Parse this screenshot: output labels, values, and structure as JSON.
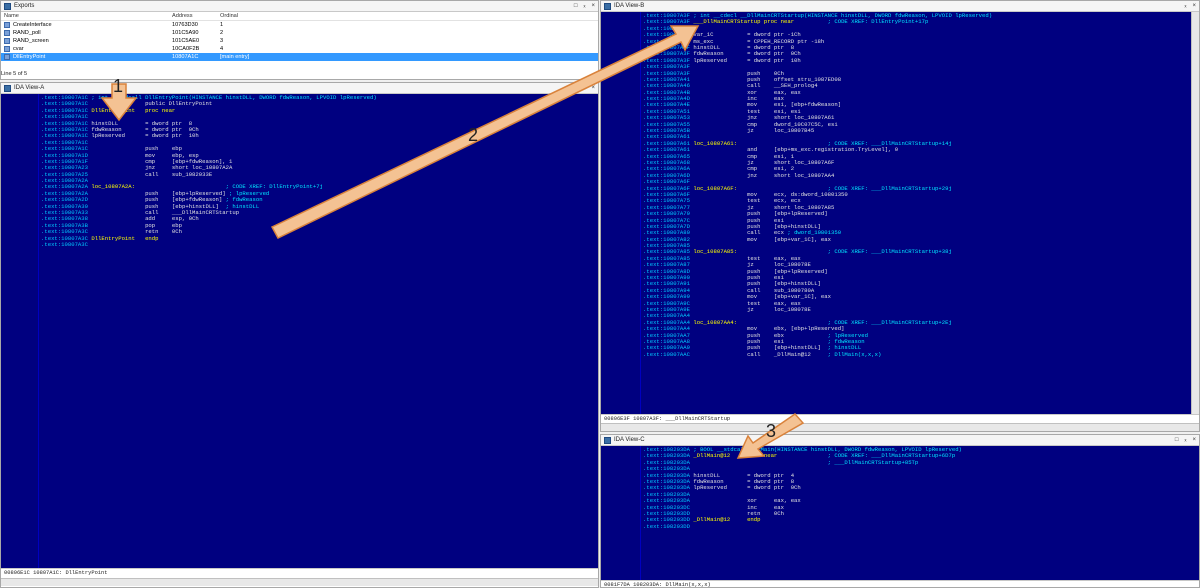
{
  "exports": {
    "title": "Exports",
    "columns": [
      "Name",
      "Address",
      "Ordinal"
    ],
    "rows": [
      {
        "name": "CreateInterface",
        "address": "10763D30",
        "ordinal": "1"
      },
      {
        "name": "RAND_poll",
        "address": "101C5A90",
        "ordinal": "2"
      },
      {
        "name": "RAND_screen",
        "address": "101C5AE0",
        "ordinal": "3"
      },
      {
        "name": "cvar",
        "address": "10CA0F2B",
        "ordinal": "4"
      },
      {
        "name": "DllEntryPoint",
        "address": "10807A1C",
        "ordinal": "[main entry]"
      }
    ],
    "status": "Line 5 of 5"
  },
  "viewA": {
    "title": "IDA View-A",
    "status": "00806E1C 10807A1C: DllEntryPoint",
    "lines": [
      ".text:10807A1C ; int __stdcall DllEntryPoint(HINSTANCE hinstDLL, DWORD fdwReason, LPVOID lpReserved)",
      ".text:10807A1C                 public DllEntryPoint",
      ".text:10807A1C DllEntryPoint   proc near",
      ".text:10807A1C",
      ".text:10807A1C hinstDLL        = dword ptr  8",
      ".text:10807A1C fdwReason       = dword ptr  0Ch",
      ".text:10807A1C lpReserved      = dword ptr  10h",
      ".text:10807A1C",
      ".text:10807A1C                 push    ebp",
      ".text:10807A1D                 mov     ebp, esp",
      ".text:10807A1F                 cmp     [ebp+fdwReason], 1",
      ".text:10807A23                 jnz     short loc_10807A2A",
      ".text:10807A25                 call    sub_1082033E",
      ".text:10807A2A",
      ".text:10807A2A loc_10807A2A:                           ; CODE XREF: DllEntryPoint+7j",
      ".text:10807A2A                 push    [ebp+lpReserved] ; lpReserved",
      ".text:10807A2D                 push    [ebp+fdwReason] ; fdwReason",
      ".text:10807A30                 push    [ebp+hinstDLL]  ; hinstDLL",
      ".text:10807A33                 call    ___DllMainCRTStartup",
      ".text:10807A38                 add     esp, 0Ch",
      ".text:10807A3B                 pop     ebp",
      ".text:10807A3C                 retn    0Ch",
      ".text:10807A3C DllEntryPoint   endp",
      ".text:10807A3C"
    ]
  },
  "viewB": {
    "title": "IDA View-B",
    "status": "00806E3F 10807A3F: ___DllMainCRTStartup",
    "lines": [
      ".text:10807A3F ; int __cdecl __DllMainCRTStartup(HINSTANCE hinstDLL, DWORD fdwReason, LPVOID lpReserved)",
      ".text:10807A3F ___DllMainCRTStartup proc near          ; CODE XREF: DllEntryPoint+17p",
      ".text:10807A3F",
      ".text:10807A3F var_1C          = dword ptr -1Ch",
      ".text:10807A3F ms_exc          = CPPEH_RECORD ptr -18h",
      ".text:10807A3F hinstDLL        = dword ptr  8",
      ".text:10807A3F fdwReason       = dword ptr  0Ch",
      ".text:10807A3F lpReserved      = dword ptr  10h",
      ".text:10807A3F",
      ".text:10807A3F                 push    0Ch",
      ".text:10807A41                 push    offset stru_1087ED08",
      ".text:10807A46                 call    __SEH_prolog4",
      ".text:10807A4B                 xor     eax, eax",
      ".text:10807A4D                 inc     eax",
      ".text:10807A4E                 mov     esi, [ebp+fdwReason]",
      ".text:10807A51                 test    esi, esi",
      ".text:10807A53                 jnz     short loc_10807A61",
      ".text:10807A55                 cmp     dword_10C07C5C, esi",
      ".text:10807A5B                 jz      loc_10807B45",
      ".text:10807A61",
      ".text:10807A61 loc_10807A61:                           ; CODE XREF: ___DllMainCRTStartup+14j",
      ".text:10807A61                 and     [ebp+ms_exc.registration.TryLevel], 0",
      ".text:10807A65                 cmp     esi, 1",
      ".text:10807A68                 jz      short loc_10807A6F",
      ".text:10807A6A                 cmp     esi, 2",
      ".text:10807A6D                 jnz     short loc_10807AA4",
      ".text:10807A6F",
      ".text:10807A6F loc_10807A6F:                           ; CODE XREF: ___DllMainCRTStartup+29j",
      ".text:10807A6F                 mov     ecx, ds:dword_10801350",
      ".text:10807A75                 test    ecx, ecx",
      ".text:10807A77                 jz      short loc_10807A85",
      ".text:10807A79                 push    [ebp+lpReserved]",
      ".text:10807A7C                 push    esi",
      ".text:10807A7D                 push    [ebp+hinstDLL]",
      ".text:10807A80                 call    ecx ; dword_10801350",
      ".text:10807A82                 mov     [ebp+var_1C], eax",
      ".text:10807A85",
      ".text:10807A85 loc_10807A85:                           ; CODE XREF: ___DllMainCRTStartup+38j",
      ".text:10807A85                 test    eax, eax",
      ".text:10807A87                 jz      loc_108078E",
      ".text:10807A8D                 push    [ebp+lpReserved]",
      ".text:10807A90                 push    esi",
      ".text:10807A91                 push    [ebp+hinstDLL]",
      ".text:10807A94                 call    sub_1080780A",
      ".text:10807A99                 mov     [ebp+var_1C], eax",
      ".text:10807A9C                 test    eax, eax",
      ".text:10807A9E                 jz      loc_108078E",
      ".text:10807AA4",
      ".text:10807AA4 loc_10807AA4:                           ; CODE XREF: ___DllMainCRTStartup+2Ej",
      ".text:10807AA4                 mov     ebx, [ebp+lpReserved]",
      ".text:10807AA7                 push    ebx             ; lpReserved",
      ".text:10807AA8                 push    esi             ; fdwReason",
      ".text:10807AA9                 push    [ebp+hinstDLL]  ; hinstDLL",
      ".text:10807AAC                 call    _DllMain@12     ; DllMain(x,x,x)"
    ]
  },
  "viewC": {
    "title": "IDA View-C",
    "status": "0081F7DA 108203DA: DllMain(x,x,x)",
    "lines": [
      ".text:108203DA ; BOOL __stdcall DllMain(HINSTANCE hinstDLL, DWORD fdwReason, LPVOID lpReserved)",
      ".text:108203DA _DllMain@12     proc near               ; CODE XREF: ___DllMainCRTStartup+6D7p",
      ".text:108203DA                                         ; ___DllMainCRTStartup+85Tp",
      ".text:108203DA",
      ".text:108203DA hinstDLL        = dword ptr  4",
      ".text:108203DA fdwReason       = dword ptr  8",
      ".text:108203DA lpReserved      = dword ptr  0Ch",
      ".text:108203DA",
      ".text:108203DA                 xor     eax, eax",
      ".text:108203DC                 inc     eax",
      ".text:108203DD                 retn    0Ch",
      ".text:108203DD _DllMain@12     endp",
      ".text:108203DD"
    ]
  },
  "callouts": [
    "1",
    "2",
    "3"
  ],
  "window_controls": [
    "□",
    "ₓ",
    "×"
  ],
  "colors": {
    "ida_bg": "#000080",
    "address": "#00c8ff",
    "label": "#ffff00",
    "arrow_fill": "#f4c293",
    "arrow_stroke": "#d9823b",
    "selection": "#3399ff"
  }
}
